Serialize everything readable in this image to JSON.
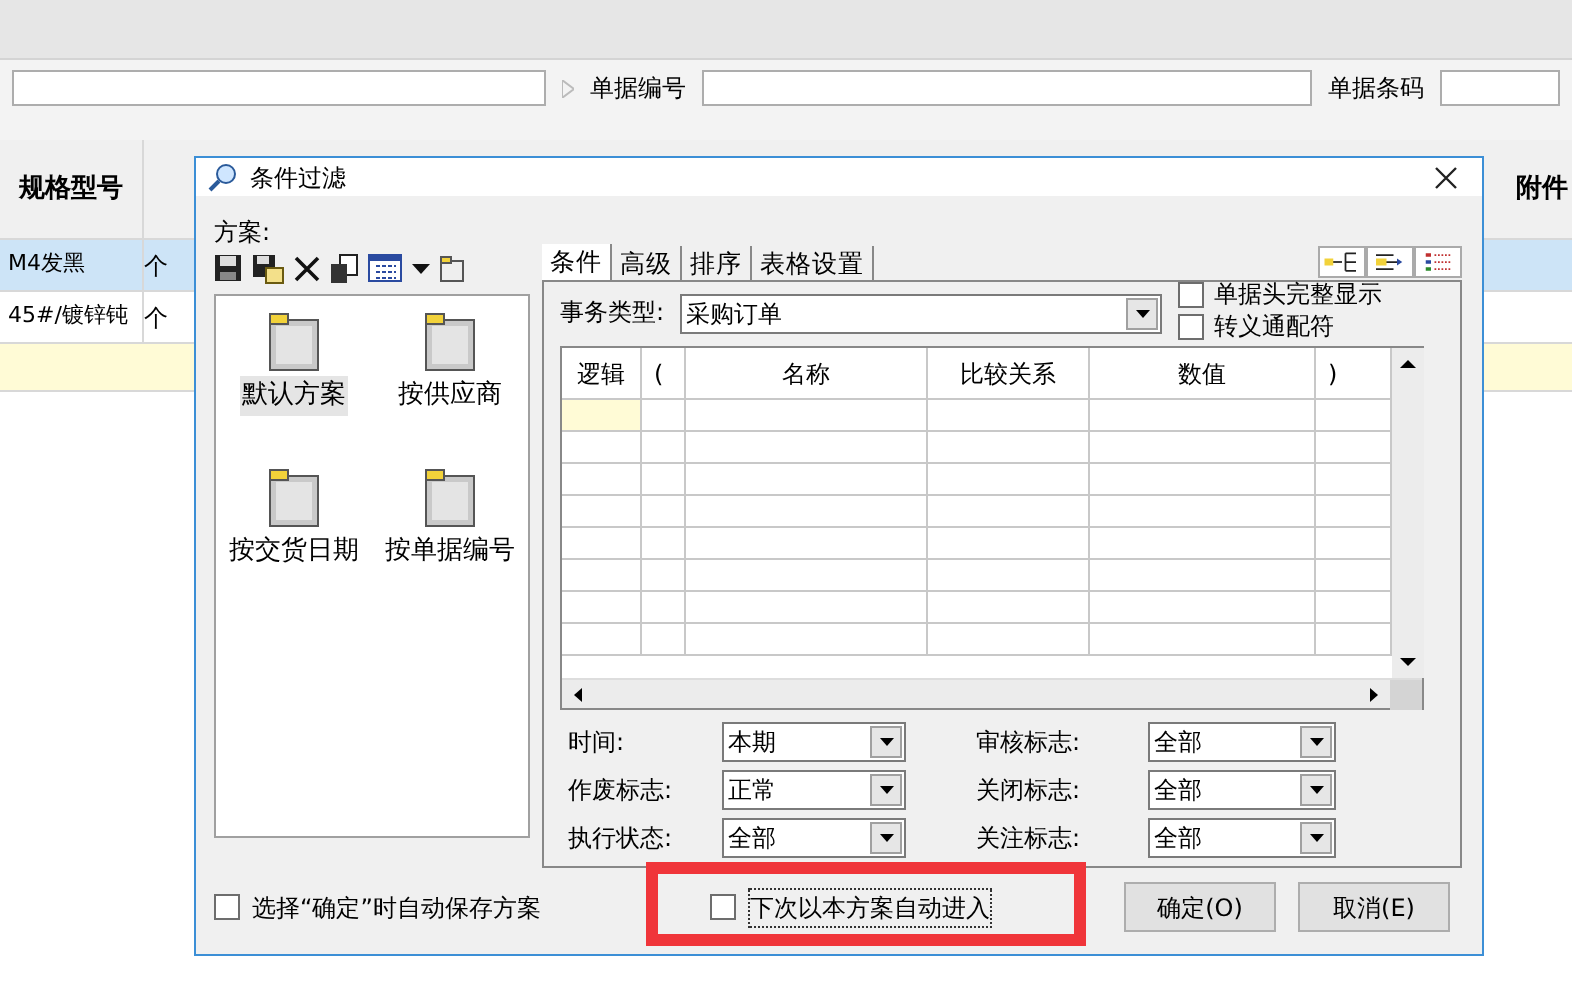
{
  "background": {
    "filters": [
      {
        "label": "单据编号"
      },
      {
        "label": "单据条码"
      }
    ],
    "columns": [
      "规格型号",
      "附件"
    ],
    "rows": [
      {
        "cells": [
          "M4发黑",
          "个"
        ],
        "selected": true
      },
      {
        "cells": [
          "45#/镀锌钝",
          "个"
        ],
        "selected": false
      }
    ]
  },
  "dialog": {
    "title": "条件过滤",
    "schemes": {
      "label": "方案:",
      "items": [
        {
          "label": "默认方案",
          "selected": true
        },
        {
          "label": "按供应商",
          "selected": false
        },
        {
          "label": "按交货日期",
          "selected": false
        },
        {
          "label": "按单据编号",
          "selected": false
        }
      ]
    },
    "tabs": [
      {
        "label": "条件",
        "selected": true
      },
      {
        "label": "高级",
        "selected": false
      },
      {
        "label": "排序",
        "selected": false
      },
      {
        "label": "表格设置",
        "selected": false
      }
    ],
    "transaction_type": {
      "label": "事务类型:",
      "value": "采购订单"
    },
    "options": [
      {
        "label": "单据头完整显示",
        "checked": false
      },
      {
        "label": "转义通配符",
        "checked": false
      }
    ],
    "grid": {
      "columns": [
        "逻辑",
        "(",
        "名称",
        "比较关系",
        "数值",
        ")"
      ]
    },
    "filters": [
      {
        "label": "时间:",
        "value": "本期"
      },
      {
        "label": "审核标志:",
        "value": "全部"
      },
      {
        "label": "作废标志:",
        "value": "正常"
      },
      {
        "label": "关闭标志:",
        "value": "全部"
      },
      {
        "label": "执行状态:",
        "value": "全部"
      },
      {
        "label": "关注标志:",
        "value": "全部"
      }
    ],
    "auto_save": {
      "label": "选择“确定”时自动保存方案",
      "checked": false
    },
    "auto_enter": {
      "label": "下次以本方案自动进入",
      "checked": false
    },
    "buttons": [
      "确定(O)",
      "取消(E)"
    ]
  }
}
